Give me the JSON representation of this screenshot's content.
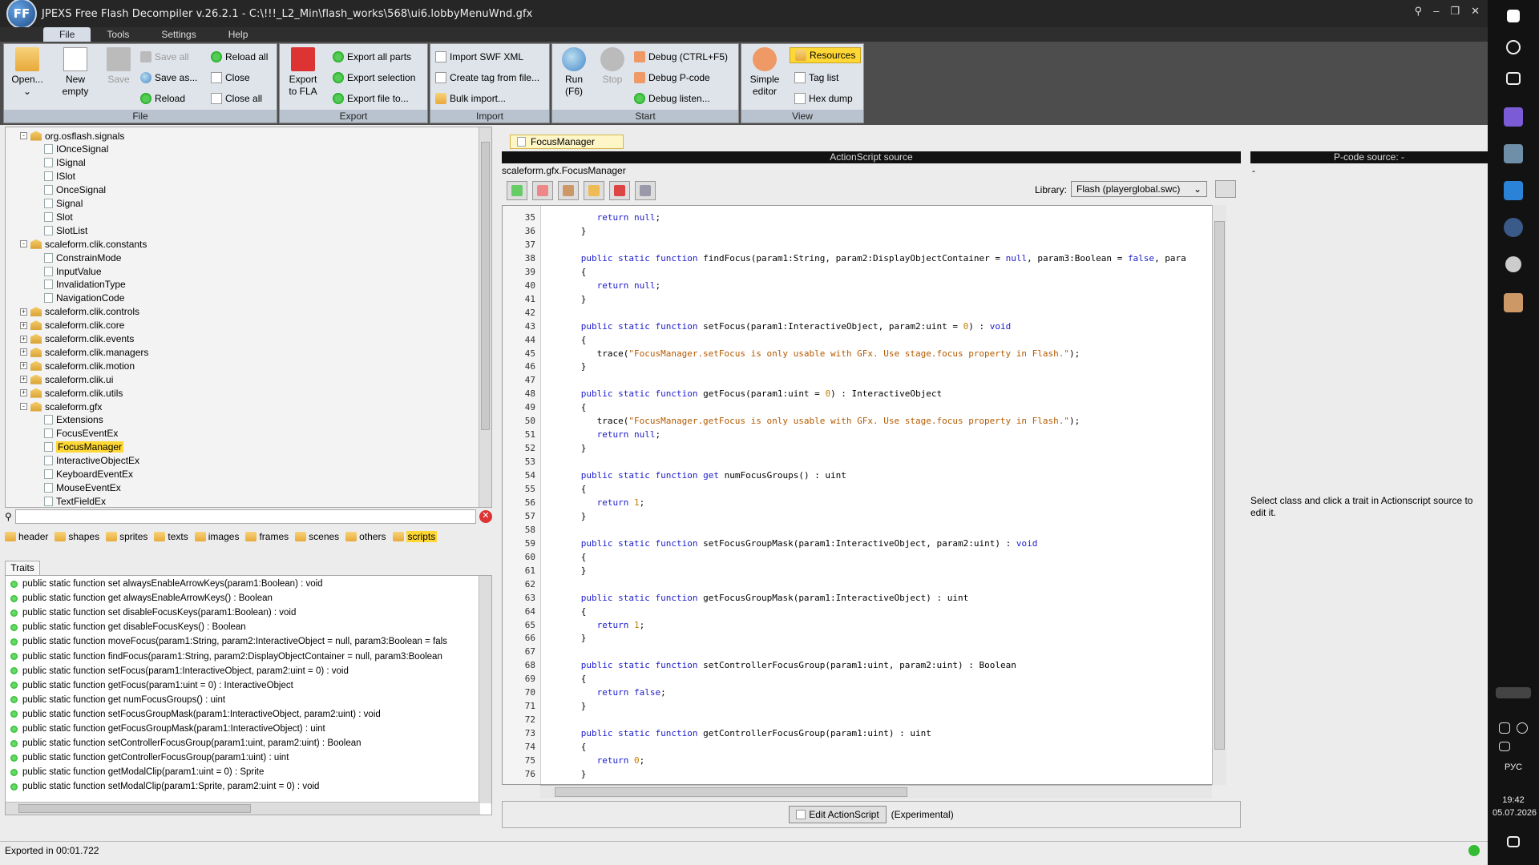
{
  "window": {
    "title": "JPEXS Free Flash Decompiler v.26.2.1 - C:\\!!!_L2_Min\\flash_works\\568\\ui6.lobbyMenuWnd.gfx",
    "logo": "FFdec"
  },
  "menu": [
    "File",
    "Tools",
    "Settings",
    "Help"
  ],
  "ribbon": {
    "file": {
      "label": "File",
      "open": "Open...",
      "new_empty": "New\nempty",
      "save": "Save",
      "save_all": "Save all",
      "save_as": "Save as...",
      "reload": "Reload",
      "reload_all": "Reload all",
      "close": "Close",
      "close_all": "Close all"
    },
    "export": {
      "label": "Export",
      "export_fla": "Export\nto FLA",
      "export_all": "Export all parts",
      "export_sel": "Export selection",
      "export_file": "Export file to..."
    },
    "import": {
      "label": "Import",
      "swf_xml": "Import SWF XML",
      "create_tag": "Create tag from file...",
      "bulk": "Bulk import..."
    },
    "start": {
      "label": "Start",
      "run": "Run\n(F6)",
      "stop": "Stop",
      "debug": "Debug (CTRL+F5)",
      "debug_pcode": "Debug P-code",
      "debug_listen": "Debug listen..."
    },
    "view": {
      "label": "View",
      "simple": "Simple\neditor",
      "resources": "Resources",
      "tag_list": "Tag list",
      "hex_dump": "Hex dump"
    }
  },
  "tree": [
    {
      "t": "pkg",
      "exp": "-",
      "label": "org.osflash.signals",
      "lvl": 1
    },
    {
      "t": "cls",
      "label": "IOnceSignal",
      "lvl": 2
    },
    {
      "t": "cls",
      "label": "ISignal",
      "lvl": 2
    },
    {
      "t": "cls",
      "label": "ISlot",
      "lvl": 2
    },
    {
      "t": "cls",
      "label": "OnceSignal",
      "lvl": 2
    },
    {
      "t": "cls",
      "label": "Signal",
      "lvl": 2
    },
    {
      "t": "cls",
      "label": "Slot",
      "lvl": 2
    },
    {
      "t": "cls",
      "label": "SlotList",
      "lvl": 2
    },
    {
      "t": "pkg",
      "exp": "-",
      "label": "scaleform.clik.constants",
      "lvl": 1
    },
    {
      "t": "cls",
      "label": "ConstrainMode",
      "lvl": 2
    },
    {
      "t": "cls",
      "label": "InputValue",
      "lvl": 2
    },
    {
      "t": "cls",
      "label": "InvalidationType",
      "lvl": 2
    },
    {
      "t": "cls",
      "label": "NavigationCode",
      "lvl": 2
    },
    {
      "t": "pkg",
      "exp": "+",
      "label": "scaleform.clik.controls",
      "lvl": 1
    },
    {
      "t": "pkg",
      "exp": "+",
      "label": "scaleform.clik.core",
      "lvl": 1
    },
    {
      "t": "pkg",
      "exp": "+",
      "label": "scaleform.clik.events",
      "lvl": 1
    },
    {
      "t": "pkg",
      "exp": "+",
      "label": "scaleform.clik.managers",
      "lvl": 1
    },
    {
      "t": "pkg",
      "exp": "+",
      "label": "scaleform.clik.motion",
      "lvl": 1
    },
    {
      "t": "pkg",
      "exp": "+",
      "label": "scaleform.clik.ui",
      "lvl": 1
    },
    {
      "t": "pkg",
      "exp": "+",
      "label": "scaleform.clik.utils",
      "lvl": 1
    },
    {
      "t": "pkg",
      "exp": "-",
      "label": "scaleform.gfx",
      "lvl": 1
    },
    {
      "t": "cls",
      "label": "Extensions",
      "lvl": 2
    },
    {
      "t": "cls",
      "label": "FocusEventEx",
      "lvl": 2
    },
    {
      "t": "cls",
      "label": "FocusManager",
      "lvl": 2,
      "selected": true
    },
    {
      "t": "cls",
      "label": "InteractiveObjectEx",
      "lvl": 2
    },
    {
      "t": "cls",
      "label": "KeyboardEventEx",
      "lvl": 2
    },
    {
      "t": "cls",
      "label": "MouseEventEx",
      "lvl": 2
    },
    {
      "t": "cls",
      "label": "TextFieldEx",
      "lvl": 2
    }
  ],
  "tag_tabs": [
    {
      "label": "header"
    },
    {
      "label": "shapes"
    },
    {
      "label": "sprites"
    },
    {
      "label": "texts"
    },
    {
      "label": "images"
    },
    {
      "label": "frames"
    },
    {
      "label": "scenes"
    },
    {
      "label": "others"
    },
    {
      "label": "scripts",
      "active": true
    }
  ],
  "traits_tab": "Traits",
  "traits": [
    "public static function set alwaysEnableArrowKeys(param1:Boolean) : void",
    "public static function get alwaysEnableArrowKeys() : Boolean",
    "public static function set disableFocusKeys(param1:Boolean) : void",
    "public static function get disableFocusKeys() : Boolean",
    "public static function moveFocus(param1:String, param2:InteractiveObject = null, param3:Boolean = fals",
    "public static function findFocus(param1:String, param2:DisplayObjectContainer = null, param3:Boolean",
    "public static function setFocus(param1:InteractiveObject, param2:uint = 0) : void",
    "public static function getFocus(param1:uint = 0) : InteractiveObject",
    "public static function get numFocusGroups() : uint",
    "public static function setFocusGroupMask(param1:InteractiveObject, param2:uint) : void",
    "public static function getFocusGroupMask(param1:InteractiveObject) : uint",
    "public static function setControllerFocusGroup(param1:uint, param2:uint) : Boolean",
    "public static function getControllerFocusGroup(param1:uint) : uint",
    "public static function getModalClip(param1:uint = 0) : Sprite",
    "public static function setModalClip(param1:Sprite, param2:uint = 0) : void"
  ],
  "doc_tab": "FocusManager",
  "as_header": "ActionScript source",
  "pc_header": "P-code source: -",
  "class_path": "scaleform.gfx.FocusManager",
  "library": {
    "label": "Library:",
    "value": "Flash (playerglobal.swc)"
  },
  "code": [
    {
      "n": "35",
      "s": "         <k>return</k> <k>null</k>;"
    },
    {
      "n": "36",
      "s": "      }"
    },
    {
      "n": "37",
      "s": ""
    },
    {
      "n": "38",
      "s": "      <k>public</k> <k>static</k> <k>function</k> findFocus(param1:String, param2:DisplayObjectContainer = <k>null</k>, param3:Boolean = <k>false</k>, para"
    },
    {
      "n": "39",
      "s": "      {"
    },
    {
      "n": "40",
      "s": "         <k>return</k> <k>null</k>;"
    },
    {
      "n": "41",
      "s": "      }"
    },
    {
      "n": "42",
      "s": ""
    },
    {
      "n": "43",
      "s": "      <k>public</k> <k>static</k> <k>function</k> setFocus(param1:InteractiveObject, param2:uint = <m>0</m>) : <k>void</k>"
    },
    {
      "n": "44",
      "s": "      {"
    },
    {
      "n": "45",
      "s": "         trace(<q>\"FocusManager.setFocus is only usable with GFx. Use stage.focus property in Flash.\"</q>);"
    },
    {
      "n": "46",
      "s": "      }"
    },
    {
      "n": "47",
      "s": ""
    },
    {
      "n": "48",
      "s": "      <k>public</k> <k>static</k> <k>function</k> getFocus(param1:uint = <m>0</m>) : InteractiveObject"
    },
    {
      "n": "49",
      "s": "      {"
    },
    {
      "n": "50",
      "s": "         trace(<q>\"FocusManager.getFocus is only usable with GFx. Use stage.focus property in Flash.\"</q>);"
    },
    {
      "n": "51",
      "s": "         <k>return</k> <k>null</k>;"
    },
    {
      "n": "52",
      "s": "      }"
    },
    {
      "n": "53",
      "s": ""
    },
    {
      "n": "54",
      "s": "      <k>public</k> <k>static</k> <k>function</k> <k>get</k> numFocusGroups() : uint"
    },
    {
      "n": "55",
      "s": "      {"
    },
    {
      "n": "56",
      "s": "         <k>return</k> <m>1</m>;"
    },
    {
      "n": "57",
      "s": "      }"
    },
    {
      "n": "58",
      "s": ""
    },
    {
      "n": "59",
      "s": "      <k>public</k> <k>static</k> <k>function</k> setFocusGroupMask(param1:InteractiveObject, param2:uint) : <k>void</k>"
    },
    {
      "n": "60",
      "s": "      {"
    },
    {
      "n": "61",
      "s": "      }"
    },
    {
      "n": "62",
      "s": ""
    },
    {
      "n": "63",
      "s": "      <k>public</k> <k>static</k> <k>function</k> getFocusGroupMask(param1:InteractiveObject) : uint"
    },
    {
      "n": "64",
      "s": "      {"
    },
    {
      "n": "65",
      "s": "         <k>return</k> <m>1</m>;"
    },
    {
      "n": "66",
      "s": "      }"
    },
    {
      "n": "67",
      "s": ""
    },
    {
      "n": "68",
      "s": "      <k>public</k> <k>static</k> <k>function</k> setControllerFocusGroup(param1:uint, param2:uint) : Boolean"
    },
    {
      "n": "69",
      "s": "      {"
    },
    {
      "n": "70",
      "s": "         <k>return</k> <k>false</k>;"
    },
    {
      "n": "71",
      "s": "      }"
    },
    {
      "n": "72",
      "s": ""
    },
    {
      "n": "73",
      "s": "      <k>public</k> <k>static</k> <k>function</k> getControllerFocusGroup(param1:uint) : uint"
    },
    {
      "n": "74",
      "s": "      {"
    },
    {
      "n": "75",
      "s": "         <k>return</k> <m>0</m>;"
    },
    {
      "n": "76",
      "s": "      }"
    }
  ],
  "edit_button": "Edit ActionScript",
  "edit_note": "(Experimental)",
  "pcode_dash": "-",
  "pcode_hint": "Select class and click a trait in Actionscript source to edit it.",
  "status": "Exported in 00:01.722",
  "taskbar": {
    "lang": "РУС",
    "time": "19:42",
    "date": "05.07.2026"
  },
  "colors": {
    "keyword": "#1b1bcc",
    "string": "#b35a00",
    "number": "#c28000",
    "selection": "#ffd836"
  }
}
